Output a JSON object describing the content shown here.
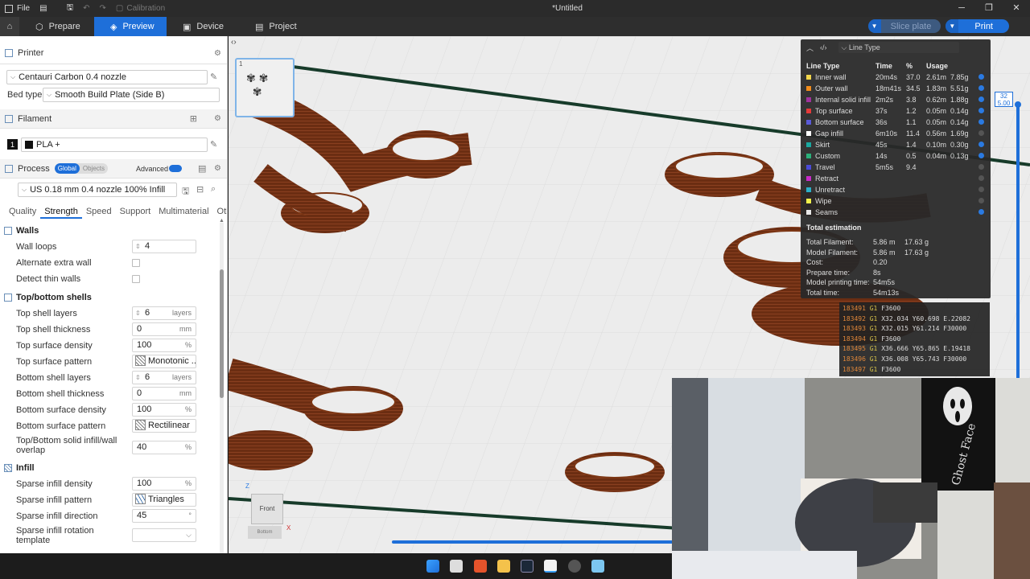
{
  "titlebar": {
    "file": "File",
    "calibration": "Calibration",
    "window_title": "*Untitled"
  },
  "nav": {
    "tabs": [
      {
        "label": "Prepare"
      },
      {
        "label": "Preview"
      },
      {
        "label": "Device"
      },
      {
        "label": "Project"
      }
    ],
    "active_tab": "Preview",
    "slice_label": "Slice plate",
    "print_label": "Print"
  },
  "sidebar": {
    "printer_title": "Printer",
    "printer_value": "Centauri Carbon 0.4 nozzle",
    "bed_type_label": "Bed type",
    "bed_type_value": "Smooth Build Plate (Side B)",
    "filament_title": "Filament",
    "filament_index": "1",
    "filament_value": "PLA +",
    "process_title": "Process",
    "process_global": "Global",
    "process_objects": "Objects",
    "advanced_label": "Advanced",
    "process_value": "US 0.18 mm 0.4 nozzle 100% Infill",
    "tabs": [
      "Quality",
      "Strength",
      "Speed",
      "Support",
      "Multimaterial",
      "Oth..."
    ],
    "active_tab": "Strength"
  },
  "settings": {
    "walls_title": "Walls",
    "wall_loops_label": "Wall loops",
    "wall_loops_value": "4",
    "alt_extra_wall_label": "Alternate extra wall",
    "detect_thin_walls_label": "Detect thin walls",
    "topbottom_title": "Top/bottom shells",
    "top_shell_layers_label": "Top shell layers",
    "top_shell_layers_value": "6",
    "layers_unit": "layers",
    "top_shell_thickness_label": "Top shell thickness",
    "top_shell_thickness_value": "0",
    "mm_unit": "mm",
    "top_surface_density_label": "Top surface density",
    "top_surface_density_value": "100",
    "pct_unit": "%",
    "top_surface_pattern_label": "Top surface pattern",
    "top_surface_pattern_value": "Monotonic ...",
    "bottom_shell_layers_label": "Bottom shell layers",
    "bottom_shell_layers_value": "6",
    "bottom_shell_thickness_label": "Bottom shell thickness",
    "bottom_shell_thickness_value": "0",
    "bottom_surface_density_label": "Bottom surface density",
    "bottom_surface_density_value": "100",
    "bottom_surface_pattern_label": "Bottom surface pattern",
    "bottom_surface_pattern_value": "Rectilinear",
    "overlap_label": "Top/Bottom solid infill/wall overlap",
    "overlap_value": "40",
    "infill_title": "Infill",
    "sparse_density_label": "Sparse infill density",
    "sparse_density_value": "100",
    "sparse_pattern_label": "Sparse infill pattern",
    "sparse_pattern_value": "Triangles",
    "sparse_direction_label": "Sparse infill direction",
    "sparse_direction_value": "45",
    "sparse_rotation_label": "Sparse infill rotation template"
  },
  "stats": {
    "view_label": "Line Type",
    "headers": [
      "Line Type",
      "Time",
      "%",
      "Usage"
    ],
    "rows": [
      {
        "name": "Inner wall",
        "time": "20m4s",
        "pct": "37.0",
        "len": "2.61m",
        "weight": "7.85g",
        "color": "#f2d64b",
        "visible": true
      },
      {
        "name": "Outer wall",
        "time": "18m41s",
        "pct": "34.5",
        "len": "1.83m",
        "weight": "5.51g",
        "color": "#f28c1b",
        "visible": true
      },
      {
        "name": "Internal solid infill",
        "time": "2m2s",
        "pct": "3.8",
        "len": "0.62m",
        "weight": "1.88g",
        "color": "#a0329c",
        "visible": true
      },
      {
        "name": "Top surface",
        "time": "37s",
        "pct": "1.2",
        "len": "0.05m",
        "weight": "0.14g",
        "color": "#e53a3a",
        "visible": true
      },
      {
        "name": "Bottom surface",
        "time": "36s",
        "pct": "1.1",
        "len": "0.05m",
        "weight": "0.14g",
        "color": "#5a5ad8",
        "visible": true
      },
      {
        "name": "Gap infill",
        "time": "6m10s",
        "pct": "11.4",
        "len": "0.56m",
        "weight": "1.69g",
        "color": "#ffffff",
        "visible": false
      },
      {
        "name": "Skirt",
        "time": "45s",
        "pct": "1.4",
        "len": "0.10m",
        "weight": "0.30g",
        "color": "#1aa8a0",
        "visible": true
      },
      {
        "name": "Custom",
        "time": "14s",
        "pct": "0.5",
        "len": "0.04m",
        "weight": "0.13g",
        "color": "#2ab07a",
        "visible": true
      },
      {
        "name": "Travel",
        "time": "5m5s",
        "pct": "9.4",
        "len": "",
        "weight": "",
        "color": "#4a4ad8",
        "visible": false
      },
      {
        "name": "Retract",
        "time": "",
        "pct": "",
        "len": "",
        "weight": "",
        "color": "#c82ac8",
        "visible": false
      },
      {
        "name": "Unretract",
        "time": "",
        "pct": "",
        "len": "",
        "weight": "",
        "color": "#2ab0c8",
        "visible": false
      },
      {
        "name": "Wipe",
        "time": "",
        "pct": "",
        "len": "",
        "weight": "",
        "color": "#f2f24b",
        "visible": false
      },
      {
        "name": "Seams",
        "time": "",
        "pct": "",
        "len": "",
        "weight": "",
        "color": "#e8e8e8",
        "visible": true
      }
    ],
    "estimation_title": "Total estimation",
    "estimation": [
      {
        "label": "Total Filament:",
        "a": "5.86 m",
        "b": "17.63 g"
      },
      {
        "label": "Model Filament:",
        "a": "5.86 m",
        "b": "17.63 g"
      },
      {
        "label": "Cost:",
        "a": "0.20",
        "b": ""
      },
      {
        "label": "Prepare time:",
        "a": "8s",
        "b": ""
      },
      {
        "label": "Model printing time:",
        "a": "54m5s",
        "b": ""
      },
      {
        "label": "Total time:",
        "a": "54m13s",
        "b": ""
      }
    ]
  },
  "gcode": [
    {
      "ln": "183491",
      "cmd": "G1",
      "args": "F3600"
    },
    {
      "ln": "183492",
      "cmd": "G1",
      "args": "X32.034 Y60.698 E.22082"
    },
    {
      "ln": "183493",
      "cmd": "G1",
      "args": "X32.015 Y61.214 F30000"
    },
    {
      "ln": "183494",
      "cmd": "G1",
      "args": "F3600"
    },
    {
      "ln": "183495",
      "cmd": "G1",
      "args": "X36.666 Y65.865 E.19418"
    },
    {
      "ln": "183496",
      "cmd": "G1",
      "args": "X36.008 Y65.743 F30000"
    },
    {
      "ln": "183497",
      "cmd": "G1",
      "args": "F3600"
    }
  ],
  "layer": {
    "top": "32",
    "height": "5.00"
  },
  "viewcube": {
    "face": "Front",
    "bottom": "Bottom",
    "x": "X",
    "z": "Z"
  },
  "thumbnail_index": "1",
  "webcam": {
    "poster_text": "Ghost Face"
  }
}
